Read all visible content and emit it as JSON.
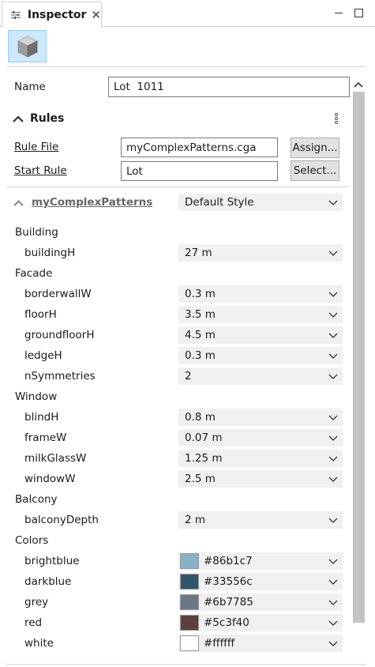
{
  "tab": {
    "title": "Inspector",
    "close": "✕"
  },
  "name": {
    "label": "Name",
    "value": "Lot  1011"
  },
  "rules": {
    "title": "Rules",
    "rule_file_label": "Rule File",
    "rule_file_value": "myComplexPatterns.cga",
    "assign_label": "Assign...",
    "start_rule_label": "Start Rule",
    "start_rule_value": "Lot",
    "select_label": "Select..."
  },
  "style": {
    "name": "myComplexPatterns",
    "value": "Default Style"
  },
  "groups": {
    "building": "Building",
    "facade": "Facade",
    "window": "Window",
    "balcony": "Balcony",
    "colors": "Colors"
  },
  "attributes": {
    "buildingH": {
      "label": "buildingH",
      "value": "27 m"
    },
    "borderwallW": {
      "label": "borderwallW",
      "value": "0.3 m"
    },
    "floorH": {
      "label": "floorH",
      "value": "3.5 m"
    },
    "groundfloorH": {
      "label": "groundfloorH",
      "value": "4.5 m"
    },
    "ledgeH": {
      "label": "ledgeH",
      "value": "0.3 m"
    },
    "nSymmetries": {
      "label": "nSymmetries",
      "value": "2"
    },
    "blindH": {
      "label": "blindH",
      "value": "0.8 m"
    },
    "frameW": {
      "label": "frameW",
      "value": "0.07 m"
    },
    "milkGlassW": {
      "label": "milkGlassW",
      "value": "1.25 m"
    },
    "windowW": {
      "label": "windowW",
      "value": "2.5 m"
    },
    "balconyDepth": {
      "label": "balconyDepth",
      "value": "2 m"
    },
    "brightblue": {
      "label": "brightblue",
      "value": "#86b1c7"
    },
    "darkblue": {
      "label": "darkblue",
      "value": "#33556c"
    },
    "grey": {
      "label": "grey",
      "value": "#6b7785"
    },
    "red": {
      "label": "red",
      "value": "#5c3f40"
    },
    "white": {
      "label": "white",
      "value": "#ffffff"
    }
  },
  "icons": {
    "tab": "sliders-icon",
    "toolbar": "cube-icon",
    "collapse": "chevron-up-icon",
    "dropdown": "chevron-down-icon",
    "menu": "kebab-menu-icon"
  }
}
